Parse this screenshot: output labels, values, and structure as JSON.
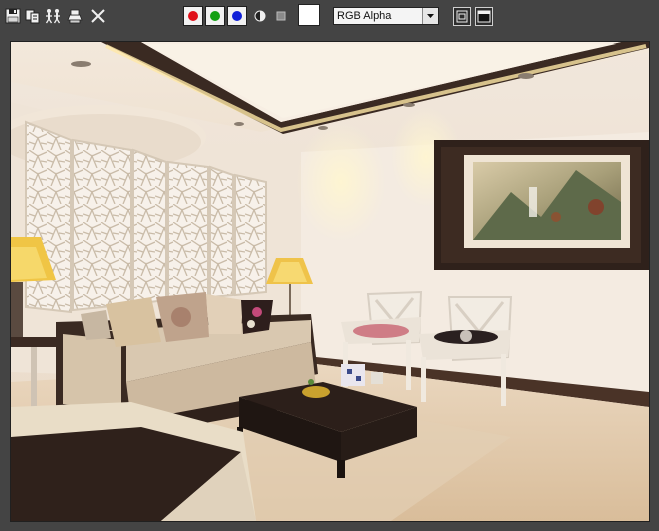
{
  "toolbar": {
    "buttons": [
      {
        "name": "save-image-button",
        "icon": "floppy-disk-icon"
      },
      {
        "name": "copy-image-button",
        "icon": "copy-icon"
      },
      {
        "name": "clone-window-button",
        "icon": "clone-people-icon"
      },
      {
        "name": "print-image-button",
        "icon": "printer-icon"
      },
      {
        "name": "clear-button",
        "icon": "close-x-icon"
      }
    ],
    "channels": [
      {
        "name": "red-channel",
        "color": "#e0101a"
      },
      {
        "name": "green-channel",
        "color": "#12a012"
      },
      {
        "name": "blue-channel",
        "color": "#1020d8"
      }
    ],
    "monochrome_icon": "half-circle-icon",
    "clear_icon": "square-icon",
    "swatch_color": "#ffffff",
    "channel_select": {
      "value": "RGB Alpha"
    },
    "frame_buttons": [
      {
        "name": "view-frame-button",
        "icon": "overlay-frame-icon"
      },
      {
        "name": "display-frame-button",
        "icon": "display-frame-icon"
      }
    ]
  },
  "viewport": {
    "content": "rendered-living-room-image"
  }
}
